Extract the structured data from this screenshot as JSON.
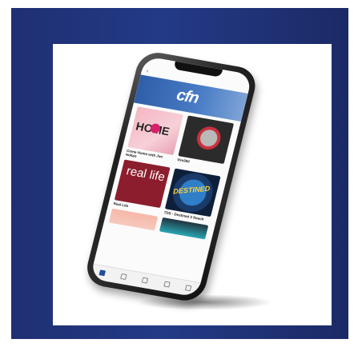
{
  "colors": {
    "frame_left": "#1f2f73",
    "frame_right": "#1b2a66",
    "inner_background": "#ffffff",
    "phone_body": "#2b2b2b",
    "banner": "#2f5ea8",
    "accent": "#1f4f9d"
  },
  "phone": {
    "banner_logo": "cfn",
    "cards": [
      {
        "thumb_text": "HOME",
        "title": "Come Home with Jim Hollan",
        "subtitle": ""
      },
      {
        "thumb_text": "",
        "title": "Vim360",
        "subtitle": ""
      },
      {
        "thumb_text": "real life",
        "title": "Real Life",
        "subtitle": ""
      },
      {
        "thumb_text": "DESTINED",
        "title": "TDS - Destined 2 Reach",
        "subtitle": ""
      }
    ]
  }
}
